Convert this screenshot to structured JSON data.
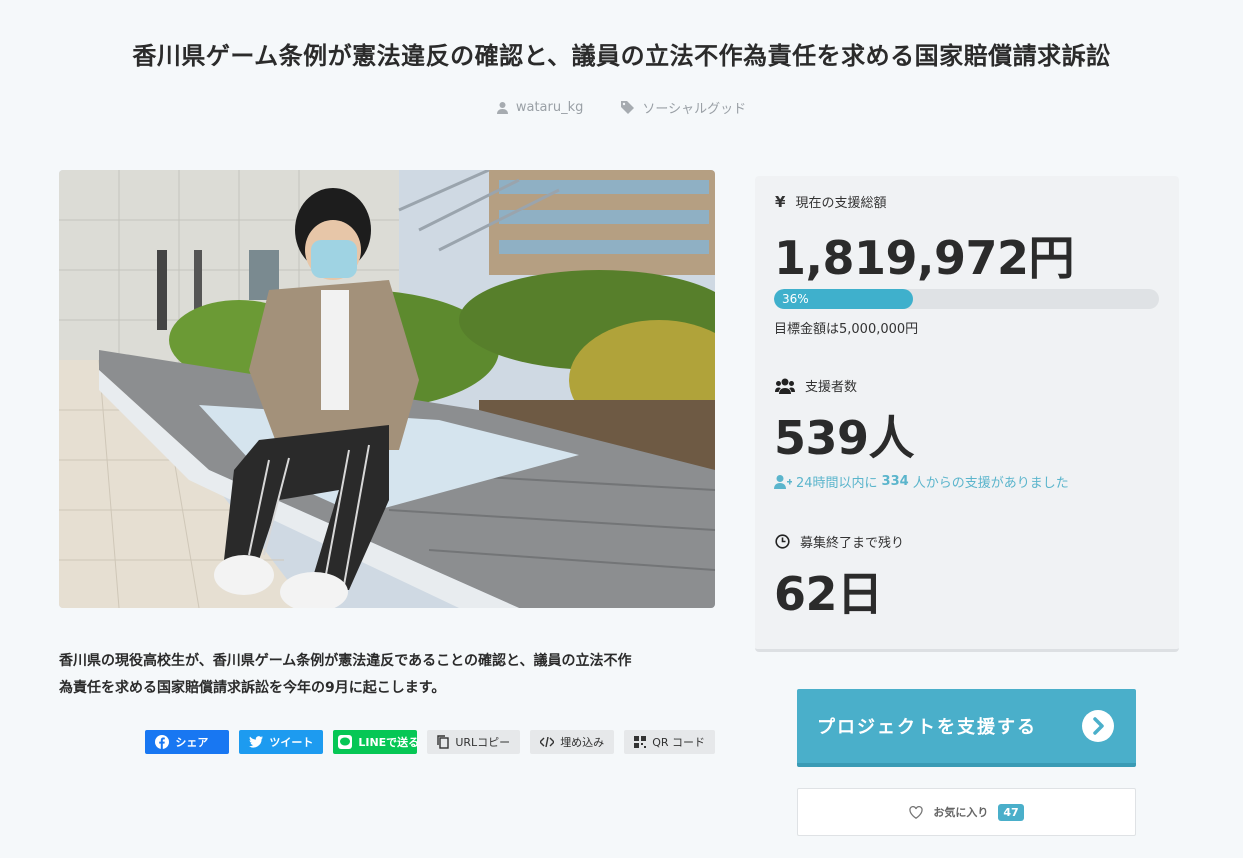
{
  "project": {
    "title": "香川県ゲーム条例が憲法違反の確認と、議員の立法不作為責任を求める国家賠償請求訴訟",
    "author": "wataru_kg",
    "category": "ソーシャルグッド",
    "lead_line1": "香川県の現役高校生が、香川県ゲーム条例が憲法違反であることの確認と、議員の立法不作",
    "lead_line2": "為責任を求める国家賠償請求訴訟を今年の9月に起こします。"
  },
  "share": {
    "facebook": "シェア",
    "twitter": "ツイート",
    "line": "LINEで送る",
    "url_copy": "URLコピー",
    "embed": "埋め込み",
    "qr": "QR コード"
  },
  "stats": {
    "total_label": "現在の支援総額",
    "total_value": "1,819,972円",
    "progress_text": "36%",
    "progress_percent": 36,
    "goal_text": "目標金額は5,000,000円",
    "backers_label": "支援者数",
    "backers_value": "539人",
    "recent_prefix": "24時間以内に",
    "recent_count": "334",
    "recent_suffix": "人からの支援がありました",
    "remaining_label": "募集終了まで残り",
    "remaining_value": "62日"
  },
  "actions": {
    "support_label": "プロジェクトを支援する",
    "favorite_label": "お気に入り",
    "favorite_count": "47"
  },
  "colors": {
    "accent": "#4aafca",
    "facebook": "#1877f2",
    "twitter": "#1d9bf0",
    "line": "#06c755"
  },
  "icons": [
    "user-icon",
    "tag-icon",
    "yen-icon",
    "users-icon",
    "user-plus-icon",
    "clock-icon",
    "chevron-circle-right-icon",
    "heart-icon",
    "facebook-icon",
    "twitter-icon",
    "line-icon",
    "copy-icon",
    "code-icon",
    "qrcode-icon"
  ]
}
